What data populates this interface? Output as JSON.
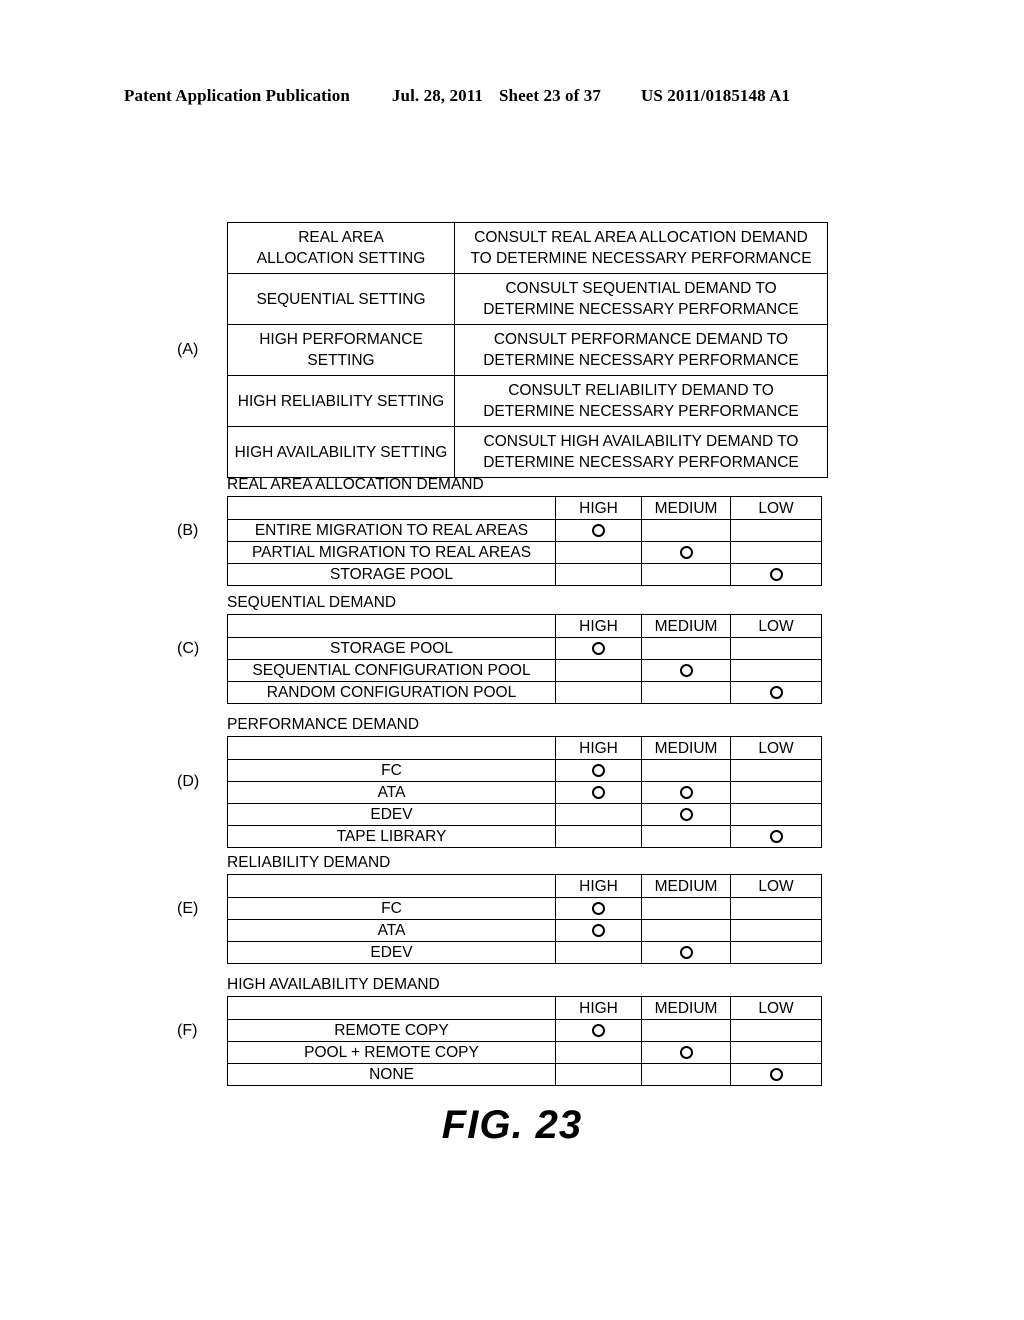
{
  "header": {
    "publication": "Patent Application Publication",
    "date": "Jul. 28, 2011",
    "sheet": "Sheet 23 of 37",
    "patent_number": "US 2011/0185148 A1"
  },
  "figure_caption": "FIG. 23",
  "columns": {
    "high": "HIGH",
    "medium": "MEDIUM",
    "low": "LOW"
  },
  "panels": {
    "a": {
      "label": "(A)",
      "rows": [
        {
          "setting": "REAL AREA\nALLOCATION SETTING",
          "action": "CONSULT REAL AREA ALLOCATION DEMAND\nTO DETERMINE NECESSARY PERFORMANCE"
        },
        {
          "setting": "SEQUENTIAL SETTING",
          "action": "CONSULT SEQUENTIAL DEMAND TO\nDETERMINE NECESSARY PERFORMANCE"
        },
        {
          "setting": "HIGH PERFORMANCE\nSETTING",
          "action": "CONSULT PERFORMANCE DEMAND TO\nDETERMINE NECESSARY PERFORMANCE"
        },
        {
          "setting": "HIGH RELIABILITY SETTING",
          "action": "CONSULT RELIABILITY DEMAND TO\nDETERMINE NECESSARY PERFORMANCE"
        },
        {
          "setting": "HIGH AVAILABILITY SETTING",
          "action": "CONSULT HIGH AVAILABILITY DEMAND TO\nDETERMINE NECESSARY PERFORMANCE"
        }
      ]
    },
    "b": {
      "label": "(B)",
      "caption": "REAL AREA ALLOCATION DEMAND",
      "rows": [
        {
          "name": "ENTIRE MIGRATION TO REAL AREAS",
          "high": true,
          "medium": false,
          "low": false
        },
        {
          "name": "PARTIAL MIGRATION TO REAL AREAS",
          "high": false,
          "medium": true,
          "low": false
        },
        {
          "name": "STORAGE POOL",
          "high": false,
          "medium": false,
          "low": true
        }
      ]
    },
    "c": {
      "label": "(C)",
      "caption": "SEQUENTIAL DEMAND",
      "rows": [
        {
          "name": "STORAGE POOL",
          "high": true,
          "medium": false,
          "low": false
        },
        {
          "name": "SEQUENTIAL CONFIGURATION POOL",
          "high": false,
          "medium": true,
          "low": false
        },
        {
          "name": "RANDOM CONFIGURATION POOL",
          "high": false,
          "medium": false,
          "low": true
        }
      ]
    },
    "d": {
      "label": "(D)",
      "caption": "PERFORMANCE DEMAND",
      "rows": [
        {
          "name": "FC",
          "high": true,
          "medium": false,
          "low": false
        },
        {
          "name": "ATA",
          "high": true,
          "medium": true,
          "low": false
        },
        {
          "name": "EDEV",
          "high": false,
          "medium": true,
          "low": false
        },
        {
          "name": "TAPE LIBRARY",
          "high": false,
          "medium": false,
          "low": true
        }
      ]
    },
    "e": {
      "label": "(E)",
      "caption": "RELIABILITY DEMAND",
      "rows": [
        {
          "name": "FC",
          "high": true,
          "medium": false,
          "low": false
        },
        {
          "name": "ATA",
          "high": true,
          "medium": false,
          "low": false
        },
        {
          "name": "EDEV",
          "high": false,
          "medium": true,
          "low": false
        }
      ]
    },
    "f": {
      "label": "(F)",
      "caption": "HIGH AVAILABILITY DEMAND",
      "rows": [
        {
          "name": "REMOTE COPY",
          "high": true,
          "medium": false,
          "low": false
        },
        {
          "name": "POOL + REMOTE COPY",
          "high": false,
          "medium": true,
          "low": false
        },
        {
          "name": "NONE",
          "high": false,
          "medium": false,
          "low": true
        }
      ]
    }
  }
}
